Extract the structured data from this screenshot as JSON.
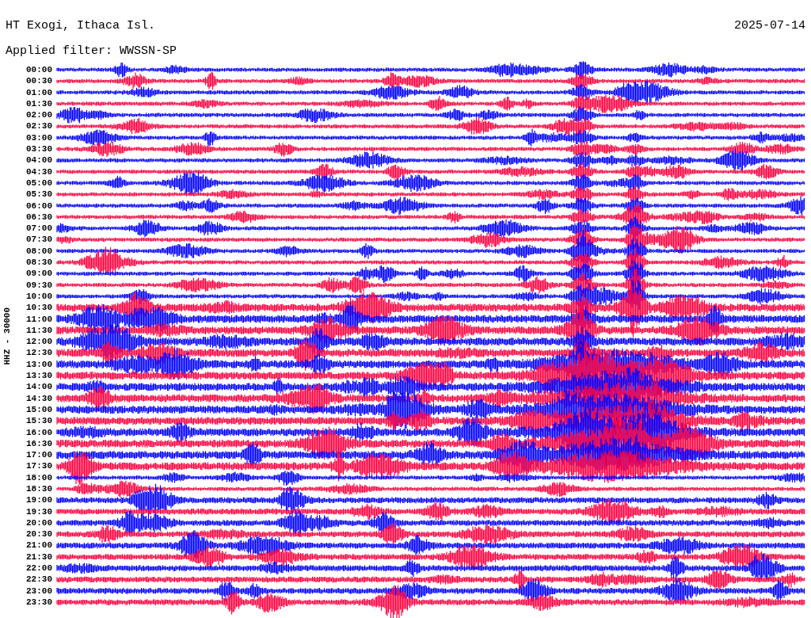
{
  "header": {
    "station": "HT Exogi, Ithaca Isl.",
    "date": "2025-07-14",
    "filter": "Applied filter: WWSSN-SP"
  },
  "channel_label": "HHZ - 30000",
  "rows": [
    {
      "time": "00:00",
      "color": "#0000ff"
    },
    {
      "time": "00:30",
      "color": "#ff0040"
    },
    {
      "time": "01:00",
      "color": "#0000ff"
    },
    {
      "time": "01:30",
      "color": "#ff0040"
    },
    {
      "time": "02:00",
      "color": "#0000ff"
    },
    {
      "time": "02:30",
      "color": "#ff0040"
    },
    {
      "time": "03:00",
      "color": "#0000ff"
    },
    {
      "time": "03:30",
      "color": "#ff0040"
    },
    {
      "time": "04:00",
      "color": "#0000ff"
    },
    {
      "time": "04:30",
      "color": "#ff0040"
    },
    {
      "time": "05:00",
      "color": "#0000ff"
    },
    {
      "time": "05:30",
      "color": "#ff0040"
    },
    {
      "time": "06:00",
      "color": "#0000ff"
    },
    {
      "time": "06:30",
      "color": "#ff0040"
    },
    {
      "time": "07:00",
      "color": "#0000ff"
    },
    {
      "time": "07:30",
      "color": "#ff0040"
    },
    {
      "time": "08:00",
      "color": "#0000ff"
    },
    {
      "time": "08:30",
      "color": "#ff0040"
    },
    {
      "time": "09:00",
      "color": "#0000ff"
    },
    {
      "time": "09:30",
      "color": "#ff0040"
    },
    {
      "time": "10:00",
      "color": "#0000ff"
    },
    {
      "time": "10:30",
      "color": "#ff0040"
    },
    {
      "time": "11:00",
      "color": "#0000ff"
    },
    {
      "time": "11:30",
      "color": "#ff0040"
    },
    {
      "time": "12:00",
      "color": "#0000ff"
    },
    {
      "time": "12:30",
      "color": "#ff0040"
    },
    {
      "time": "13:00",
      "color": "#0000ff"
    },
    {
      "time": "13:30",
      "color": "#ff0040"
    },
    {
      "time": "14:00",
      "color": "#0000ff"
    },
    {
      "time": "14:30",
      "color": "#ff0040"
    },
    {
      "time": "15:00",
      "color": "#0000ff"
    },
    {
      "time": "15:30",
      "color": "#ff0040"
    },
    {
      "time": "16:00",
      "color": "#0000ff"
    },
    {
      "time": "16:30",
      "color": "#ff0040"
    },
    {
      "time": "17:00",
      "color": "#0000ff"
    },
    {
      "time": "17:30",
      "color": "#ff0040"
    },
    {
      "time": "18:00",
      "color": "#0000ff"
    },
    {
      "time": "18:30",
      "color": "#ff0040"
    },
    {
      "time": "19:00",
      "color": "#0000ff"
    },
    {
      "time": "19:30",
      "color": "#ff0040"
    },
    {
      "time": "20:00",
      "color": "#0000ff"
    },
    {
      "time": "20:30",
      "color": "#ff0040"
    },
    {
      "time": "21:00",
      "color": "#0000ff"
    },
    {
      "time": "21:30",
      "color": "#ff0040"
    },
    {
      "time": "22:00",
      "color": "#0000ff"
    },
    {
      "time": "22:30",
      "color": "#ff0040"
    },
    {
      "time": "23:00",
      "color": "#0000ff"
    },
    {
      "time": "23:30",
      "color": "#ff0040"
    }
  ]
}
